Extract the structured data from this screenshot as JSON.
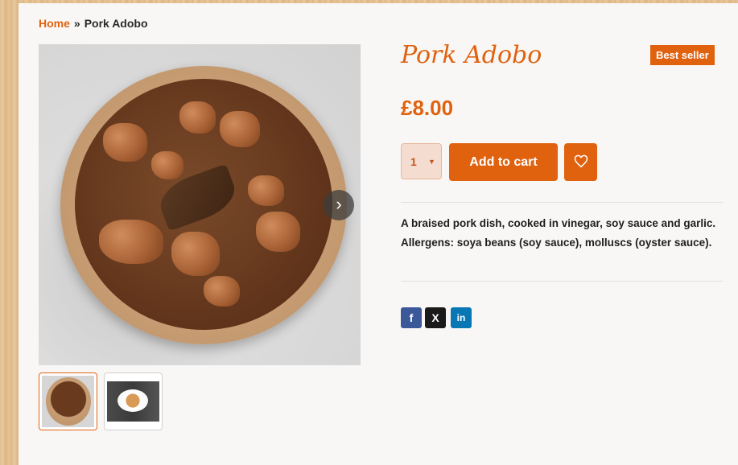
{
  "breadcrumb": {
    "home": "Home",
    "separator": "»",
    "current": "Pork Adobo"
  },
  "product": {
    "title": "Pork Adobo",
    "badge": "Best seller",
    "price": "£8.00",
    "quantity": "1",
    "add_to_cart_label": "Add to cart",
    "description": "A braised pork dish, cooked in vinegar, soy sauce and garlic.  Allergens: soya beans (soy sauce), molluscs (oyster sauce).",
    "images_count": 2
  },
  "share": [
    {
      "network": "facebook",
      "glyph": "f"
    },
    {
      "network": "x",
      "glyph": "X"
    },
    {
      "network": "linkedin",
      "glyph": "in"
    }
  ],
  "colors": {
    "accent": "#e0620f",
    "panel": "#f9f7f5"
  }
}
